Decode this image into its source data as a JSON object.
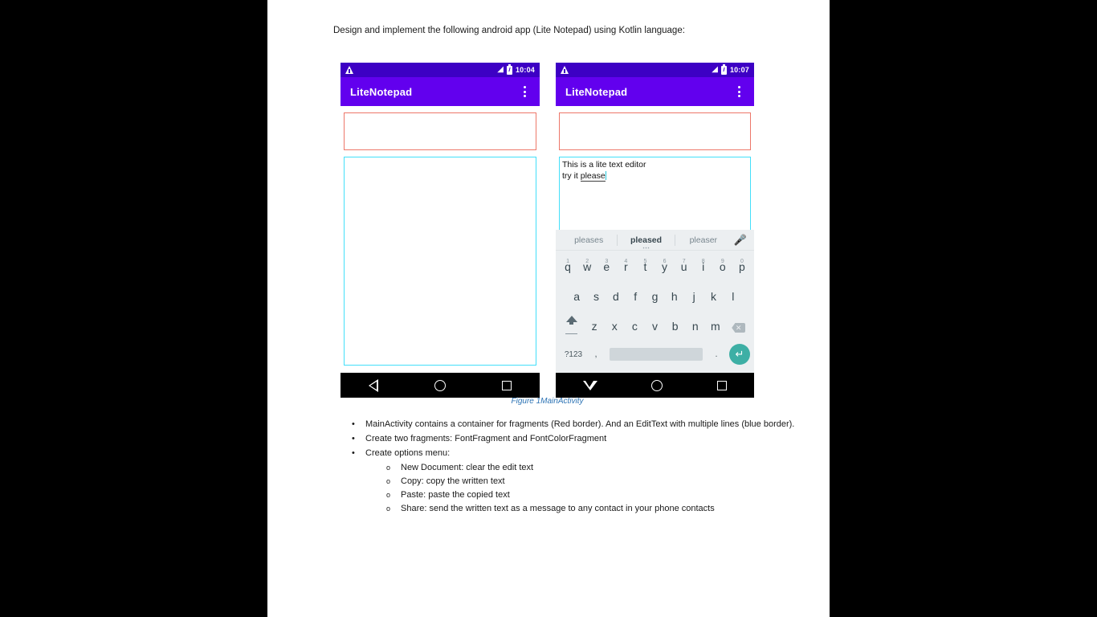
{
  "intro": "Design and implement the following android app (Lite Notepad) using Kotlin language:",
  "caption": "Figure 1MainActivity",
  "colors": {
    "appbar_purple": "#6200EE",
    "statusbar_purple": "#3D00C4",
    "fragment_border_red": "#ED7769",
    "edittext_border_blue": "#43DFFA",
    "enter_key_teal": "#3DAFA5",
    "caption_blue": "#2E74B5"
  },
  "phones": [
    {
      "id": "left",
      "status": {
        "time": "10:04",
        "warning_icon": "warning-triangle-icon",
        "signal_icon": "signal-icon",
        "battery_icon": "battery-charging-icon"
      },
      "appbar": {
        "title": "LiteNotepad",
        "overflow_icon": "overflow-menu-icon"
      },
      "fragment_container_label": "fragment-container",
      "edit_text": {
        "value": "",
        "lines": []
      },
      "nav": {
        "back_icon": "back-triangle-icon",
        "home_icon": "home-circle-icon",
        "recents_icon": "recents-square-icon"
      },
      "keyboard_visible": false
    },
    {
      "id": "right",
      "status": {
        "time": "10:07",
        "warning_icon": "warning-triangle-icon",
        "signal_icon": "signal-icon",
        "battery_icon": "battery-charging-icon"
      },
      "appbar": {
        "title": "LiteNotepad",
        "overflow_icon": "overflow-menu-icon"
      },
      "fragment_container_label": "fragment-container",
      "edit_text": {
        "line1": "This is a lite text editor",
        "line2_prefix": "try it ",
        "line2_composing": "please"
      },
      "nav": {
        "back_icon": "keyboard-dismiss-triangle-icon",
        "home_icon": "home-circle-icon",
        "recents_icon": "recents-square-icon"
      },
      "keyboard_visible": true
    }
  ],
  "keyboard": {
    "suggestions": [
      {
        "text": "pleases",
        "selected": false
      },
      {
        "text": "pleased",
        "selected": true
      },
      {
        "text": "pleaser",
        "selected": false
      }
    ],
    "mic_icon": "microphone-icon",
    "row1": [
      {
        "key": "q",
        "num": "1"
      },
      {
        "key": "w",
        "num": "2"
      },
      {
        "key": "e",
        "num": "3"
      },
      {
        "key": "r",
        "num": "4"
      },
      {
        "key": "t",
        "num": "5"
      },
      {
        "key": "y",
        "num": "6"
      },
      {
        "key": "u",
        "num": "7"
      },
      {
        "key": "i",
        "num": "8"
      },
      {
        "key": "o",
        "num": "9"
      },
      {
        "key": "p",
        "num": "0"
      }
    ],
    "row2": [
      "a",
      "s",
      "d",
      "f",
      "g",
      "h",
      "j",
      "k",
      "l"
    ],
    "row3": [
      "z",
      "x",
      "c",
      "v",
      "b",
      "n",
      "m"
    ],
    "shift_icon": "shift-icon",
    "backspace_icon": "backspace-icon",
    "symbols_key": "?123",
    "comma_key": ",",
    "period_key": ".",
    "space_key": "",
    "enter_icon": "enter-key-icon"
  },
  "bullets": [
    {
      "text": "MainActivity contains a container for fragments (Red border). And an EditText with multiple lines (blue border)."
    },
    {
      "text": "Create two fragments: FontFragment and FontColorFragment"
    },
    {
      "text": "Create options menu:"
    }
  ],
  "sub_bullets": [
    {
      "text": "New Document: clear the edit text"
    },
    {
      "text": "Copy: copy the written text"
    },
    {
      "text": "Paste: paste the copied text"
    },
    {
      "text": "Share: send the written text as a message to any contact in your phone contacts"
    }
  ]
}
